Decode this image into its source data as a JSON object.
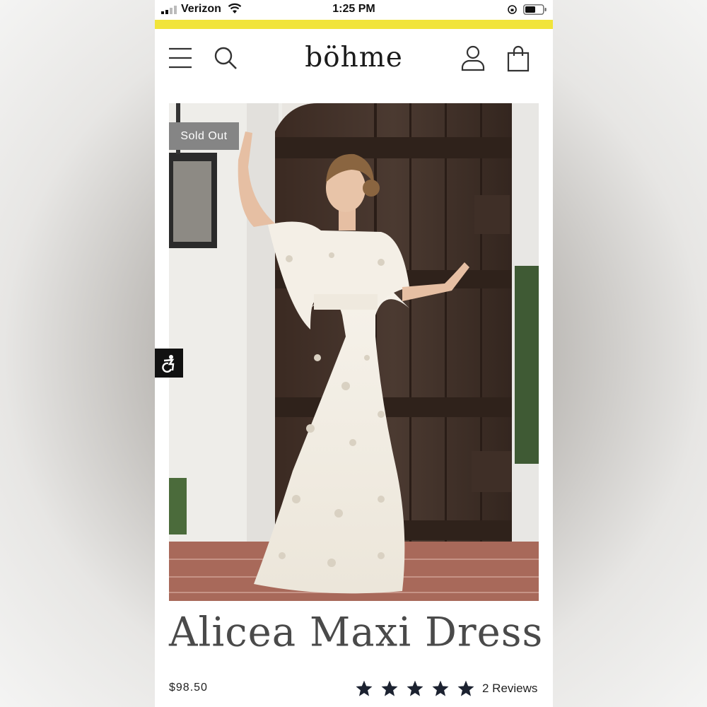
{
  "status_bar": {
    "carrier": "Verizon",
    "time": "1:25 PM"
  },
  "header": {
    "logo": "böhme",
    "icons": [
      "menu-icon",
      "search-icon",
      "account-icon",
      "cart-icon"
    ]
  },
  "product": {
    "badge": "Sold Out",
    "name": "Alicea Maxi Dress",
    "price": "$98.50",
    "rating": 5,
    "rating_max": 5,
    "reviews": "2 Reviews"
  },
  "colors": {
    "banner": "#f1e43a",
    "badge": "#858585",
    "text": "#222222"
  }
}
